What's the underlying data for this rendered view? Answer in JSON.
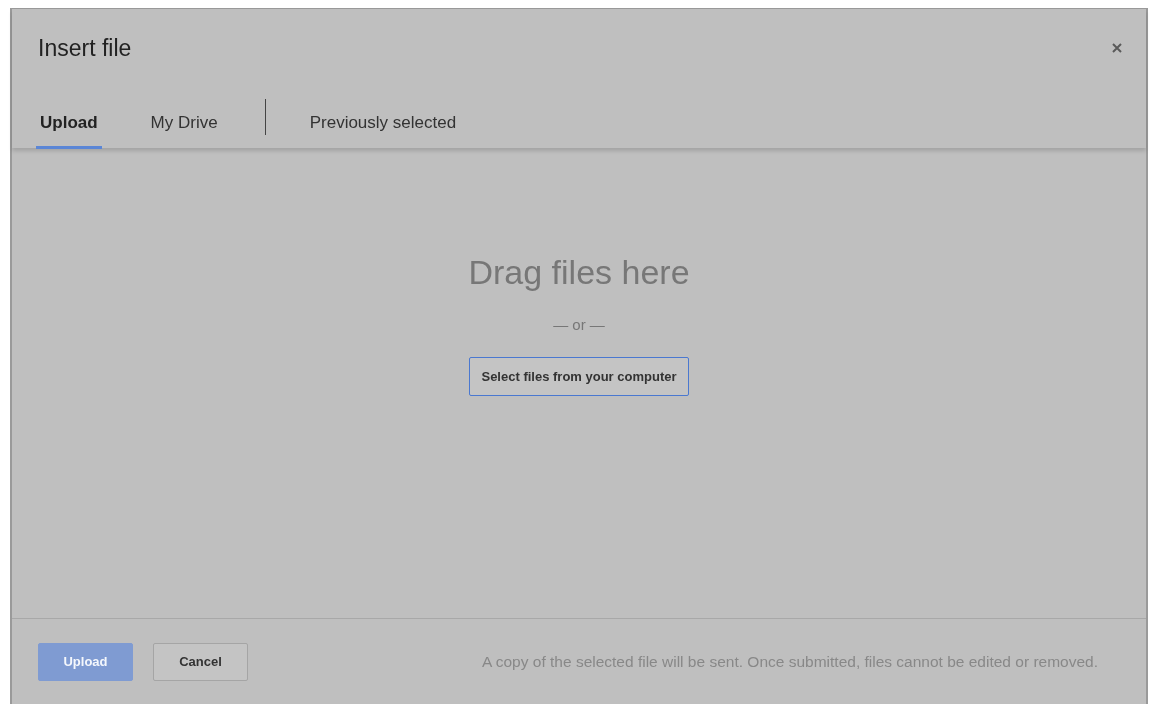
{
  "dialog": {
    "title": "Insert file"
  },
  "tabs": [
    {
      "label": "Upload",
      "selected": true
    },
    {
      "label": "My Drive",
      "selected": false
    },
    {
      "label": "Previously selected",
      "selected": false
    }
  ],
  "drop_area": {
    "heading": "Drag files here",
    "separator": "— or —",
    "button": "Select files from your computer"
  },
  "footer": {
    "buttons": [
      {
        "label": "Upload",
        "kind": "primary",
        "disabled": true
      },
      {
        "label": "Cancel",
        "kind": "secondary",
        "disabled": false
      }
    ],
    "note": "A copy of the selected file will be sent. Once submitted, files cannot be edited or removed."
  }
}
